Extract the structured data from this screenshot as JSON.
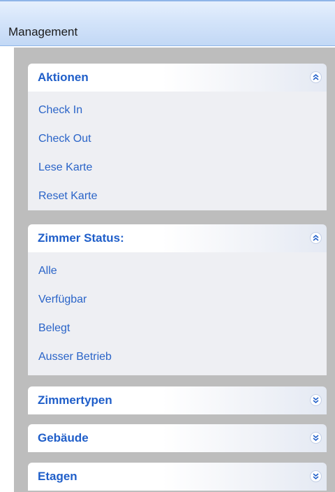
{
  "header": {
    "title": "Management"
  },
  "groups": [
    {
      "title": "Aktionen",
      "expanded": true,
      "items": [
        "Check In",
        "Check Out",
        "Lese Karte",
        "Reset Karte"
      ]
    },
    {
      "title": "Zimmer Status:",
      "expanded": true,
      "items": [
        "Alle",
        "Verfügbar",
        "Belegt",
        "Ausser Betrieb"
      ]
    },
    {
      "title": "Zimmertypen",
      "expanded": false,
      "items": []
    },
    {
      "title": "Gebäude",
      "expanded": false,
      "items": []
    },
    {
      "title": "Etagen",
      "expanded": false,
      "items": []
    }
  ],
  "icons": {
    "collapse": "collapse-chevrons-icon",
    "expand": "expand-chevrons-icon"
  },
  "colors": {
    "accent_text": "#1f5ec9",
    "link_text": "#2a64c8",
    "panel_background": "#bdbdbd",
    "group_body": "#eeeff3",
    "header_gradient_top": "#e6f0fd",
    "header_gradient_bottom": "#c2d8f5"
  }
}
